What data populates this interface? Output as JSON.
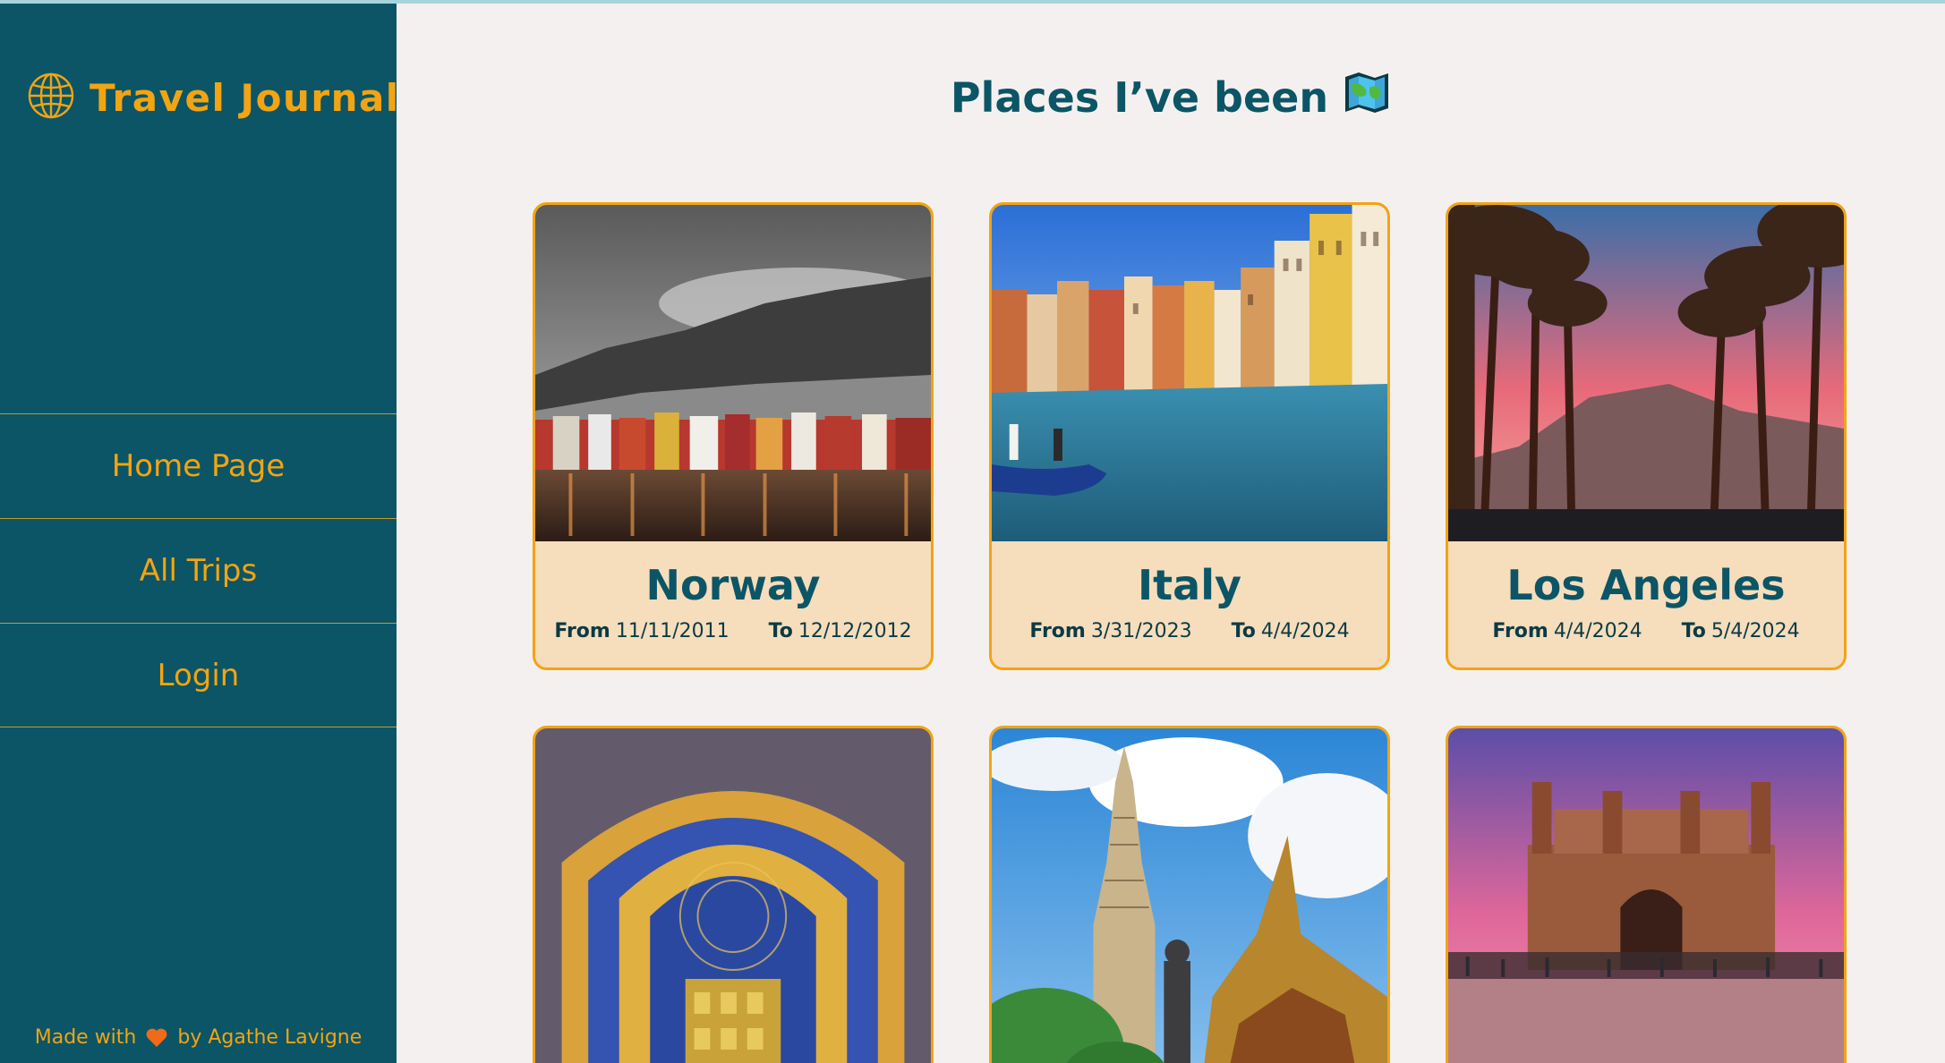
{
  "sidebar": {
    "brand_title": "Travel Journal",
    "brand_icon": "globe-icon",
    "nav": [
      {
        "label": "Home Page"
      },
      {
        "label": "All Trips"
      },
      {
        "label": "Login"
      }
    ],
    "footer": {
      "prefix": "Made with",
      "icon": "heart-icon",
      "suffix": "by Agathe Lavigne"
    }
  },
  "main": {
    "title": "Places I’ve been",
    "title_icon": "map-icon",
    "from_label": "From",
    "to_label": "To",
    "trips": [
      {
        "name": "Norway",
        "from": "11/11/2011",
        "to": "12/12/2012"
      },
      {
        "name": "Italy",
        "from": "3/31/2023",
        "to": "4/4/2024"
      },
      {
        "name": "Los Angeles",
        "from": "4/4/2024",
        "to": "5/4/2024"
      }
    ]
  },
  "colors": {
    "sidebar_bg": "#0b5566",
    "accent": "#f2a413",
    "page_bg": "#f5f0f0",
    "card_bg": "#f6ddbc",
    "heading": "#0b5566"
  }
}
